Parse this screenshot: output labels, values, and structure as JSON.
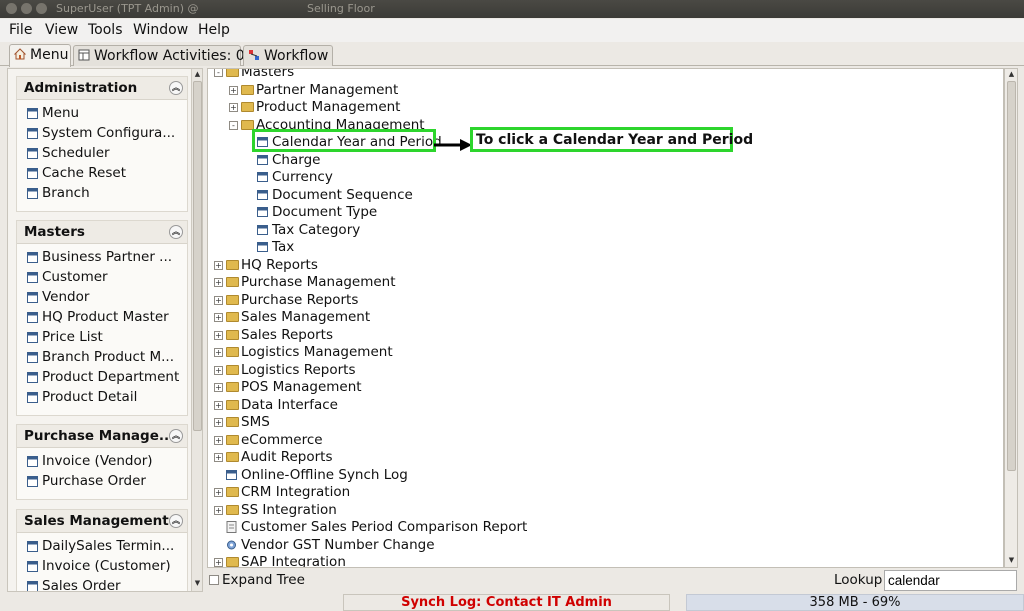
{
  "window": {
    "title": "SuperUser (TPT Admin) @",
    "subtitle": "Selling Floor"
  },
  "menu": [
    "File",
    "View",
    "Tools",
    "Window",
    "Help"
  ],
  "tabs": [
    {
      "label": "Menu"
    },
    {
      "label": "Workflow Activities: 0"
    },
    {
      "label": "Workflow"
    }
  ],
  "sidebar": [
    {
      "title": "Administration",
      "items": [
        "Menu",
        "System Configura...",
        "Scheduler",
        "Cache Reset",
        "Branch"
      ]
    },
    {
      "title": "Masters",
      "items": [
        "Business Partner ...",
        "Customer",
        "Vendor",
        "HQ Product Master",
        "Price List",
        "Branch Product M...",
        "Product Department",
        "Product Detail"
      ]
    },
    {
      "title": "Purchase Manage...",
      "items": [
        "Invoice (Vendor)",
        "Purchase Order"
      ]
    },
    {
      "title": "Sales Management",
      "items": [
        "DailySales Termin...",
        "Invoice (Customer)",
        "Sales Order"
      ]
    }
  ],
  "tree": [
    {
      "label": "Masters",
      "level": 1,
      "kind": "folder-open",
      "exp": "-"
    },
    {
      "label": "Partner Management",
      "level": 2,
      "kind": "folder",
      "exp": "+"
    },
    {
      "label": "Product Management",
      "level": 2,
      "kind": "folder",
      "exp": "+"
    },
    {
      "label": "Accounting Management",
      "level": 2,
      "kind": "folder-open",
      "exp": "-"
    },
    {
      "label": "Calendar Year and Period",
      "level": 3,
      "kind": "window"
    },
    {
      "label": "Charge",
      "level": 3,
      "kind": "window"
    },
    {
      "label": "Currency",
      "level": 3,
      "kind": "window"
    },
    {
      "label": "Document Sequence",
      "level": 3,
      "kind": "window"
    },
    {
      "label": "Document Type",
      "level": 3,
      "kind": "window"
    },
    {
      "label": "Tax Category",
      "level": 3,
      "kind": "window"
    },
    {
      "label": "Tax",
      "level": 3,
      "kind": "window"
    },
    {
      "label": "HQ Reports",
      "level": 1,
      "kind": "folder",
      "exp": "+"
    },
    {
      "label": "Purchase Management",
      "level": 1,
      "kind": "folder",
      "exp": "+"
    },
    {
      "label": "Purchase Reports",
      "level": 1,
      "kind": "folder",
      "exp": "+"
    },
    {
      "label": "Sales Management",
      "level": 1,
      "kind": "folder",
      "exp": "+"
    },
    {
      "label": "Sales Reports",
      "level": 1,
      "kind": "folder",
      "exp": "+"
    },
    {
      "label": "Logistics Management",
      "level": 1,
      "kind": "folder",
      "exp": "+"
    },
    {
      "label": "Logistics Reports",
      "level": 1,
      "kind": "folder",
      "exp": "+"
    },
    {
      "label": "POS Management",
      "level": 1,
      "kind": "folder",
      "exp": "+"
    },
    {
      "label": "Data Interface",
      "level": 1,
      "kind": "folder",
      "exp": "+"
    },
    {
      "label": "SMS",
      "level": 1,
      "kind": "folder",
      "exp": "+"
    },
    {
      "label": "eCommerce",
      "level": 1,
      "kind": "folder",
      "exp": "+"
    },
    {
      "label": "Audit Reports",
      "level": 1,
      "kind": "folder",
      "exp": "+"
    },
    {
      "label": "Online-Offline Synch Log",
      "level": 1,
      "kind": "window"
    },
    {
      "label": "CRM Integration",
      "level": 1,
      "kind": "folder",
      "exp": "+"
    },
    {
      "label": "SS Integration",
      "level": 1,
      "kind": "folder",
      "exp": "+"
    },
    {
      "label": "Customer Sales Period Comparison Report",
      "level": 1,
      "kind": "report"
    },
    {
      "label": "Vendor GST Number Change",
      "level": 1,
      "kind": "process"
    },
    {
      "label": "SAP Integration",
      "level": 1,
      "kind": "folder",
      "exp": "+"
    }
  ],
  "annotation": {
    "text": "To click a Calendar Year and Period"
  },
  "bottom": {
    "expand_tree": "Expand Tree",
    "lookup_label": "Lookup",
    "lookup_value": "calendar"
  },
  "status": {
    "synch": "Synch Log: Contact IT Admin",
    "memory": "358 MB - 69%"
  },
  "colors": {
    "highlight": "#2dd52d",
    "synch_text": "#d00000",
    "folder": "#e0b94e"
  }
}
